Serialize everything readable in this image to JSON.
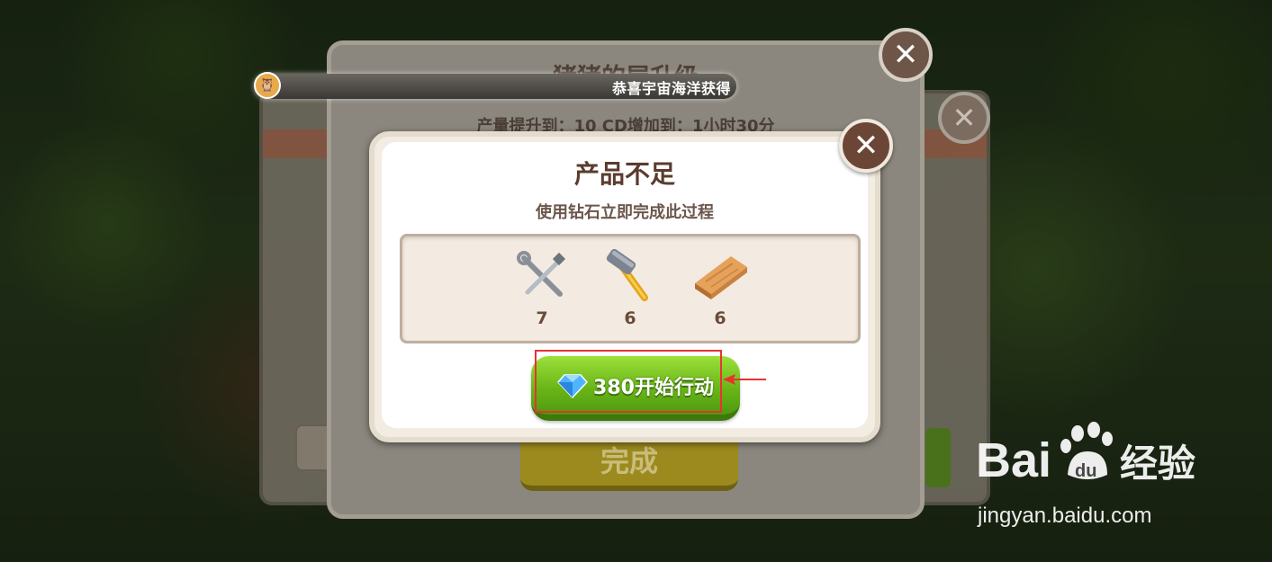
{
  "notice": {
    "text": "恭喜宇宙海洋获得"
  },
  "back_dialog": {
    "title": "猪猪的屋升级",
    "subtitle": "产量提升到：10   CD增加到：1小时30分",
    "done_label": "完成"
  },
  "dialog": {
    "title": "产品不足",
    "subtitle": "使用钻石立即完成此过程",
    "items": [
      {
        "icon": "screwdriver-and-wrench-icon",
        "count": "7"
      },
      {
        "icon": "hammer-icon",
        "count": "6"
      },
      {
        "icon": "wood-plank-icon",
        "count": "6"
      }
    ],
    "action_label": "380开始行动"
  },
  "watermark": {
    "logo_text": "Bai 经验",
    "url": "jingyan.baidu.com"
  },
  "colors": {
    "button_green": "#6ab618",
    "title_brown": "#5a3c2e",
    "highlight_red": "#e83232"
  }
}
